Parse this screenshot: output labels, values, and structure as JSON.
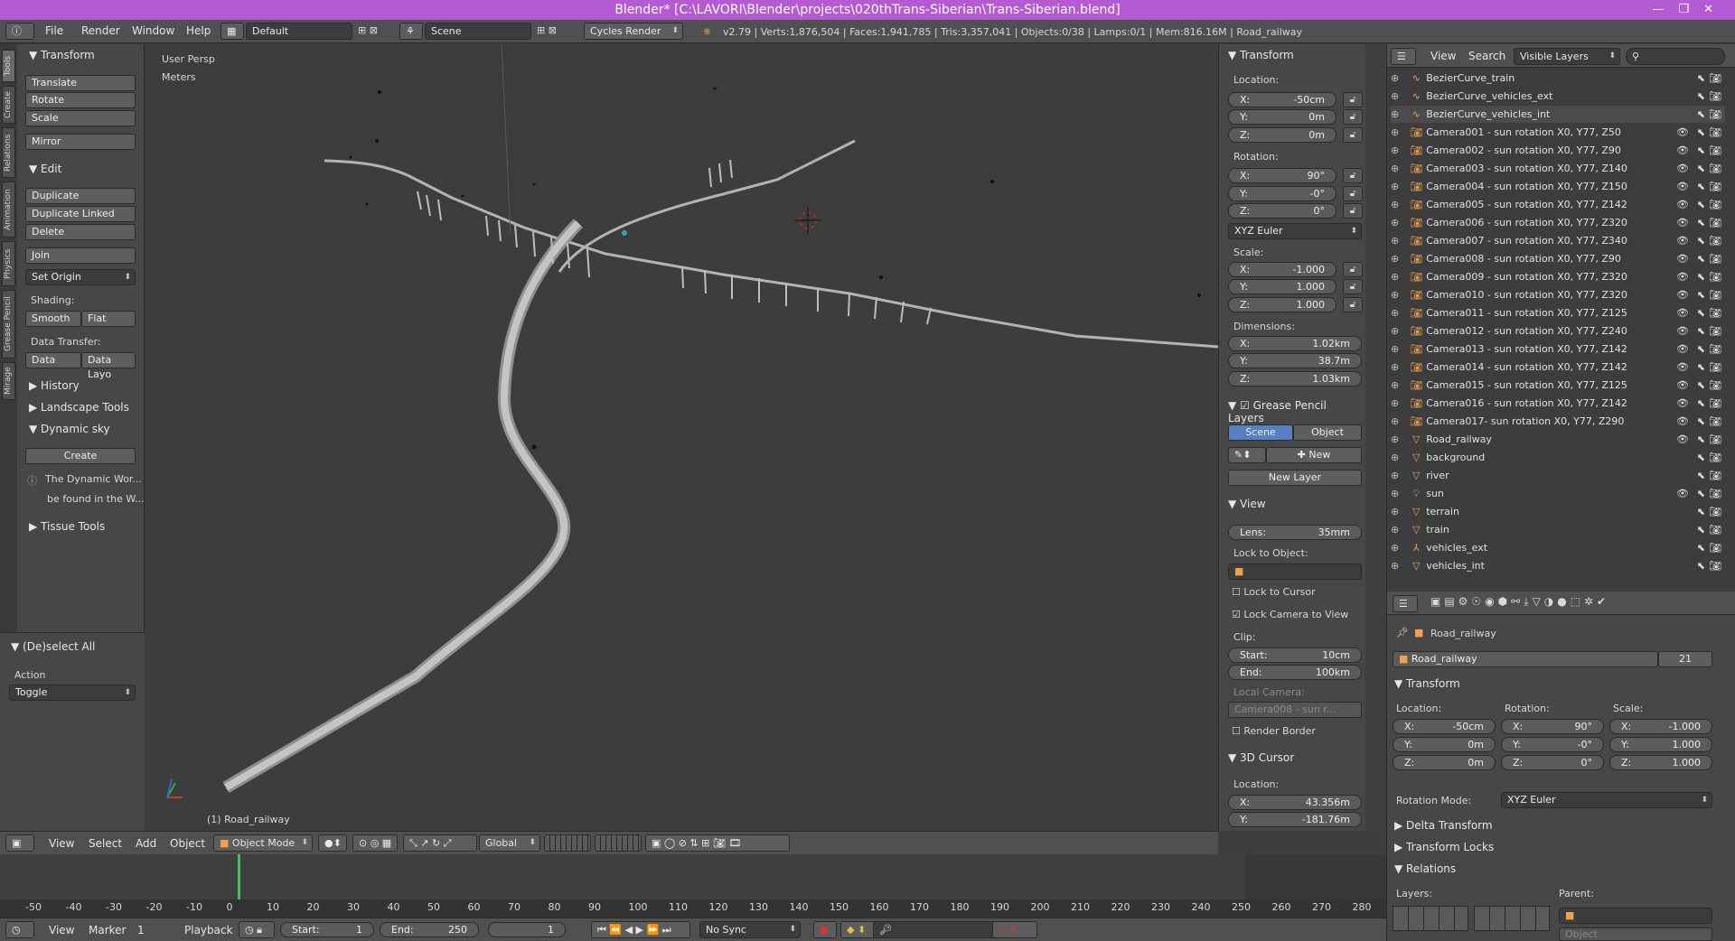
{
  "window": {
    "title": "Blender* [C:\\LAVORI\\Blender\\projects\\020thTrans-Siberian\\Trans-Siberian.blend]"
  },
  "topbar": {
    "menus": [
      "File",
      "Render",
      "Window",
      "Help"
    ],
    "layout": "Default",
    "scene": "Scene",
    "engine": "Cycles Render",
    "stats": "v2.79 | Verts:1,876,504 | Faces:1,941,785 | Tris:3,357,041 | Objects:0/38 | Lamps:0/1 | Mem:816.16M | Road_railway"
  },
  "tabs": [
    "Tools",
    "Create",
    "Relations",
    "Animation",
    "Physics",
    "Grease Pencil",
    "Mirage"
  ],
  "tools": {
    "transform_title": "Transform",
    "translate": "Translate",
    "rotate": "Rotate",
    "scale": "Scale",
    "mirror": "Mirror",
    "edit_title": "Edit",
    "duplicate": "Duplicate",
    "duplicate_linked": "Duplicate Linked",
    "delete": "Delete",
    "join": "Join",
    "set_origin": "Set Origin",
    "shading_label": "Shading:",
    "smooth": "Smooth",
    "flat": "Flat",
    "data_transfer_label": "Data Transfer:",
    "data": "Data",
    "data_layo": "Data Layo",
    "history": "History",
    "landscape": "Landscape Tools",
    "dynamic_sky": "Dynamic sky",
    "create": "Create",
    "info1": "The Dynamic Wor...",
    "info2": "be found in the W...",
    "tissue": "Tissue Tools"
  },
  "dselect": {
    "title": "(De)select All",
    "action_label": "Action",
    "action_value": "Toggle"
  },
  "viewport": {
    "persp": "User Persp",
    "units": "Meters",
    "object_label": "(1) Road_railway"
  },
  "npanel": {
    "transform": "Transform",
    "location": "Location:",
    "loc": [
      [
        "X:",
        "-50cm"
      ],
      [
        "Y:",
        "0m"
      ],
      [
        "Z:",
        "0m"
      ]
    ],
    "rotation": "Rotation:",
    "rot": [
      [
        "X:",
        "90°"
      ],
      [
        "Y:",
        "-0°"
      ],
      [
        "Z:",
        "0°"
      ]
    ],
    "euler": "XYZ Euler",
    "scale": "Scale:",
    "scl": [
      [
        "X:",
        "-1.000"
      ],
      [
        "Y:",
        "1.000"
      ],
      [
        "Z:",
        "1.000"
      ]
    ],
    "dimensions": "Dimensions:",
    "dim": [
      [
        "X:",
        "1.02km"
      ],
      [
        "Y:",
        "38.7m"
      ],
      [
        "Z:",
        "1.03km"
      ]
    ],
    "gp_title": "Grease Pencil Layers",
    "scene_tab": "Scene",
    "object_tab": "Object",
    "new": "New",
    "new_layer": "New Layer",
    "view_title": "View",
    "lens": "Lens:",
    "lens_val": "35mm",
    "lock_obj": "Lock to Object:",
    "lock_cursor": "Lock to Cursor",
    "lock_cam": "Lock Camera to View",
    "clip": "Clip:",
    "clip_start": "Start:",
    "clip_start_v": "10cm",
    "clip_end": "End:",
    "clip_end_v": "100km",
    "local_cam": "Local Camera:",
    "local_cam_v": "Camera008 - sun r...",
    "render_border": "Render Border",
    "cursor_title": "3D Cursor",
    "cursor_loc": "Location:",
    "cur": [
      [
        "X:",
        "43.356m"
      ],
      [
        "Y:",
        "-181.76m"
      ]
    ]
  },
  "outliner": {
    "view": "View",
    "search": "Search",
    "filter": "Visible Layers",
    "items": [
      {
        "name": "BezierCurve_train",
        "icon": "curve",
        "visible": false
      },
      {
        "name": "BezierCurve_vehicles_ext",
        "icon": "curve",
        "visible": false
      },
      {
        "name": "BezierCurve_vehicles_int",
        "icon": "curve",
        "visible": false
      },
      {
        "name": "Camera001 - sun rotation X0, Y77, Z50",
        "icon": "camera",
        "visible": true
      },
      {
        "name": "Camera002 - sun rotation X0, Y77, Z90",
        "icon": "camera",
        "visible": true
      },
      {
        "name": "Camera003 - sun rotation X0, Y77, Z140",
        "icon": "camera",
        "visible": true
      },
      {
        "name": "Camera004 - sun rotation X0, Y77, Z150",
        "icon": "camera",
        "visible": true
      },
      {
        "name": "Camera005 - sun rotation X0, Y77, Z142",
        "icon": "camera",
        "visible": true
      },
      {
        "name": "Camera006 - sun rotation X0, Y77, Z320",
        "icon": "camera",
        "visible": true
      },
      {
        "name": "Camera007 - sun rotation X0, Y77, Z340",
        "icon": "camera",
        "visible": true
      },
      {
        "name": "Camera008 - sun rotation X0, Y77, Z90",
        "icon": "camera",
        "visible": true
      },
      {
        "name": "Camera009 - sun rotation X0, Y77, Z320",
        "icon": "camera",
        "visible": true
      },
      {
        "name": "Camera010 - sun rotation X0, Y77, Z320",
        "icon": "camera",
        "visible": true
      },
      {
        "name": "Camera011 - sun rotation X0, Y77, Z125",
        "icon": "camera",
        "visible": true
      },
      {
        "name": "Camera012 - sun rotation X0, Y77, Z240",
        "icon": "camera",
        "visible": true
      },
      {
        "name": "Camera013 - sun rotation X0, Y77, Z142",
        "icon": "camera",
        "visible": true
      },
      {
        "name": "Camera014 - sun rotation X0, Y77, Z142",
        "icon": "camera",
        "visible": true
      },
      {
        "name": "Camera015 - sun rotation X0, Y77, Z125",
        "icon": "camera",
        "visible": true
      },
      {
        "name": "Camera016 - sun rotation X0, Y77, Z142",
        "icon": "camera",
        "visible": true
      },
      {
        "name": "Camera017- sun rotation X0, Y77, Z290",
        "icon": "camera",
        "visible": true
      },
      {
        "name": "Road_railway",
        "icon": "mesh",
        "visible": true
      },
      {
        "name": "background",
        "icon": "mesh",
        "visible": false
      },
      {
        "name": "river",
        "icon": "mesh",
        "visible": false
      },
      {
        "name": "sun",
        "icon": "lamp",
        "visible": true
      },
      {
        "name": "terrain",
        "icon": "mesh",
        "visible": false
      },
      {
        "name": "train",
        "icon": "mesh",
        "visible": false
      },
      {
        "name": "vehicles_ext",
        "icon": "empty",
        "visible": false
      },
      {
        "name": "vehicles_int",
        "icon": "mesh",
        "visible": false
      }
    ]
  },
  "props": {
    "breadcrumb": "Road_railway",
    "object_name": "Road_railway",
    "users": "21",
    "transform": "Transform",
    "location": "Location:",
    "rotation": "Rotation:",
    "scale": "Scale:",
    "loc": [
      [
        "X:",
        "-50cm"
      ],
      [
        "Y:",
        "0m"
      ],
      [
        "Z:",
        "0m"
      ]
    ],
    "rot": [
      [
        "X:",
        "90°"
      ],
      [
        "Y:",
        "-0°"
      ],
      [
        "Z:",
        "0°"
      ]
    ],
    "scl": [
      [
        "X:",
        "-1.000"
      ],
      [
        "Y:",
        "1.000"
      ],
      [
        "Z:",
        "1.000"
      ]
    ],
    "rot_mode_label": "Rotation Mode:",
    "rot_mode": "XYZ Euler",
    "delta": "Delta Transform",
    "locks": "Transform Locks",
    "relations": "Relations",
    "layers": "Layers:",
    "parent": "Parent:",
    "object": "Object"
  },
  "vpheader": {
    "view": "View",
    "select": "Select",
    "add": "Add",
    "object": "Object",
    "mode": "Object Mode",
    "orientation": "Global"
  },
  "timeline": {
    "ticks": [
      "-50",
      "-40",
      "-30",
      "-20",
      "-10",
      "0",
      "10",
      "20",
      "30",
      "40",
      "50",
      "60",
      "70",
      "80",
      "90",
      "100",
      "110",
      "120",
      "130",
      "140",
      "150",
      "160",
      "170",
      "180",
      "190",
      "200",
      "210",
      "220",
      "230",
      "240",
      "250",
      "260",
      "270",
      "280"
    ],
    "current_frame": "1"
  },
  "tlfooter": {
    "view": "View",
    "marker": "Marker",
    "frame": "1",
    "playback": "Playback",
    "start_label": "Start:",
    "start": "1",
    "end_label": "End:",
    "end": "250",
    "sync": "No Sync"
  }
}
